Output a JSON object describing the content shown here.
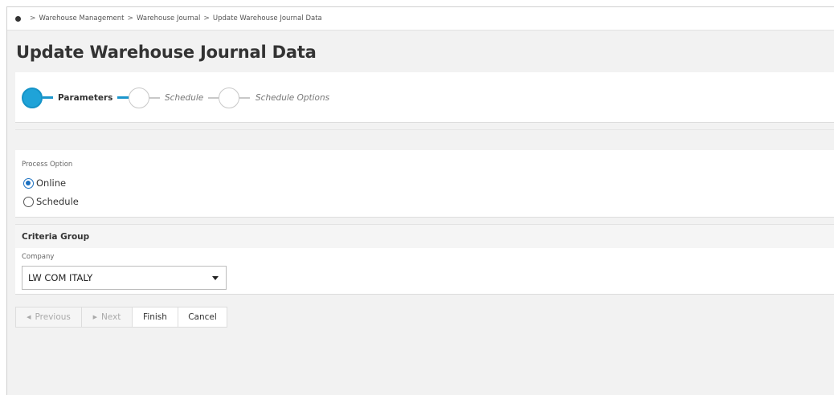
{
  "breadcrumb": {
    "items": [
      "Warehouse Management",
      "Warehouse Journal",
      "Update Warehouse Journal Data"
    ]
  },
  "page": {
    "title": "Update Warehouse Journal Data"
  },
  "wizard": {
    "steps": [
      {
        "label": "Parameters",
        "state": "active"
      },
      {
        "label": "Schedule",
        "state": "inactive"
      },
      {
        "label": "Schedule Options",
        "state": "inactive"
      }
    ],
    "accent_color": "#1fa3d8"
  },
  "process": {
    "label": "Process Option",
    "options": [
      {
        "label": "Online",
        "selected": true
      },
      {
        "label": "Schedule",
        "selected": false
      }
    ]
  },
  "criteria": {
    "title": "Criteria Group",
    "company_label": "Company",
    "company_value": "LW COM ITALY"
  },
  "buttons": {
    "previous": "Previous",
    "next": "Next",
    "finish": "Finish",
    "cancel": "Cancel"
  }
}
